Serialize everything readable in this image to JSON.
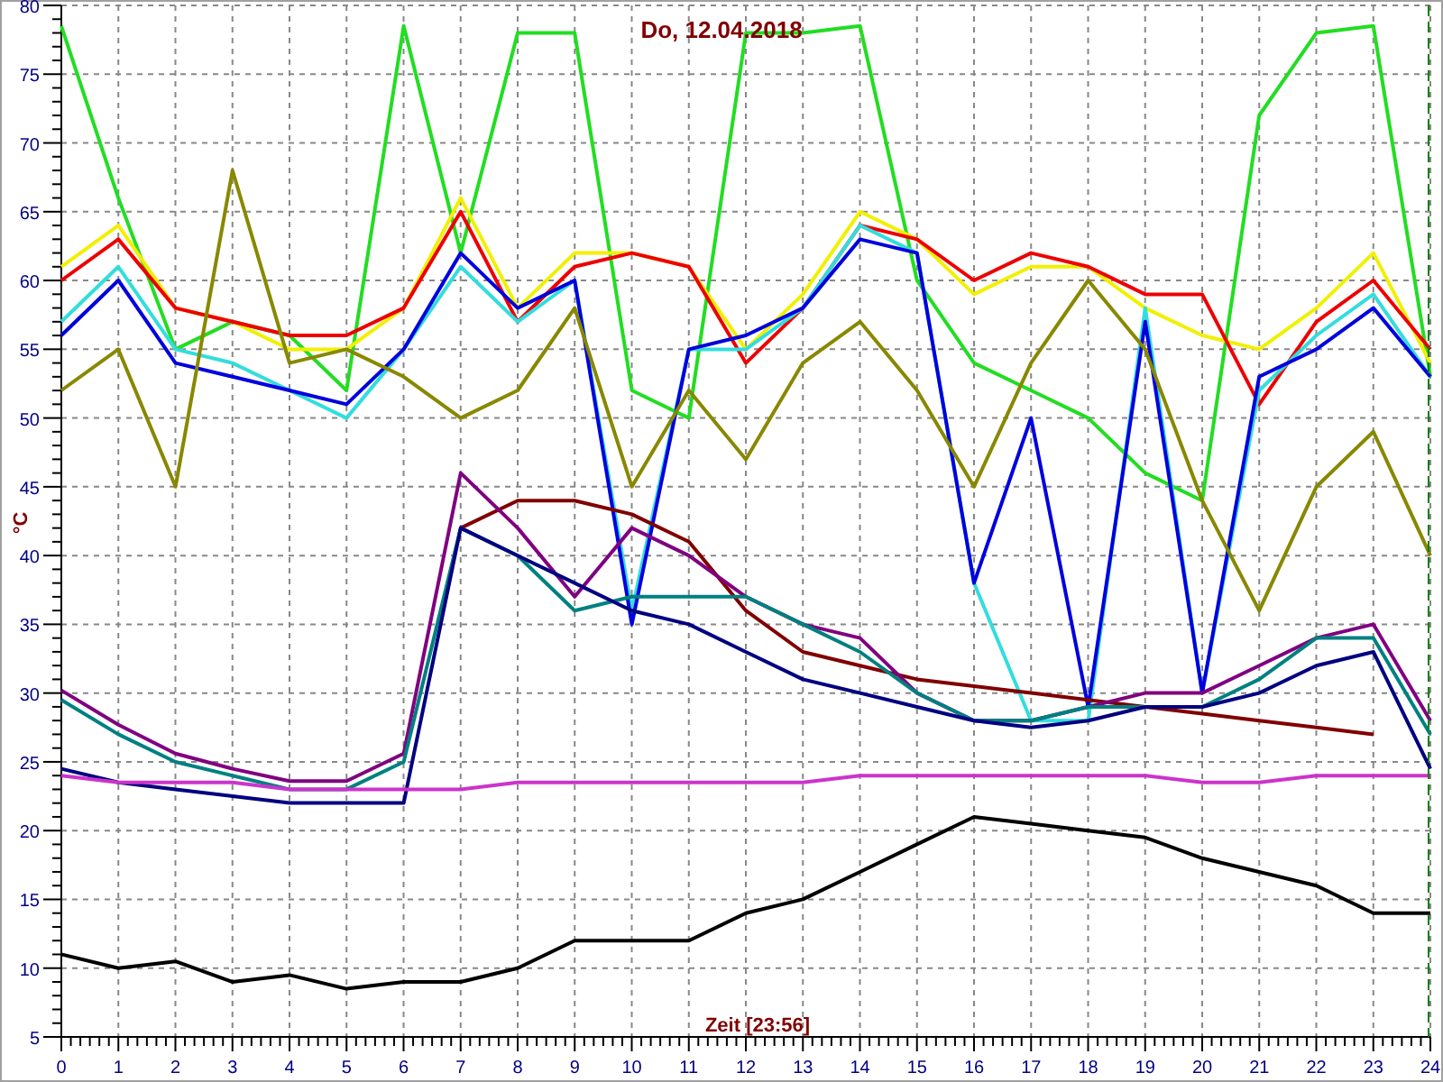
{
  "chart_data": {
    "type": "line",
    "grid": true,
    "title": "Do, 12.04.2018",
    "xlabel": "Zeit [23:56]",
    "ylabel": "°C",
    "x": [
      0,
      1,
      2,
      3,
      4,
      5,
      6,
      7,
      8,
      9,
      10,
      11,
      12,
      13,
      14,
      15,
      16,
      17,
      18,
      19,
      20,
      21,
      22,
      23,
      24
    ],
    "xlim": [
      0,
      24
    ],
    "ylim": [
      5,
      80
    ],
    "xticks": [
      0,
      1,
      2,
      3,
      4,
      5,
      6,
      7,
      8,
      9,
      10,
      11,
      12,
      13,
      14,
      15,
      16,
      17,
      18,
      19,
      20,
      21,
      22,
      23,
      24
    ],
    "yticks": [
      5,
      10,
      15,
      20,
      25,
      30,
      35,
      40,
      45,
      50,
      55,
      60,
      65,
      70,
      75,
      80
    ],
    "series": [
      {
        "color": "#22dd22",
        "values": [
          78.5,
          66,
          55,
          57,
          56,
          52,
          78.5,
          62,
          78,
          78,
          52,
          50,
          78,
          78,
          78.5,
          60,
          54,
          52,
          50,
          46,
          44,
          72,
          78,
          78.5,
          53
        ]
      },
      {
        "color": "#f0f000",
        "values": [
          61,
          64,
          58,
          57,
          55,
          55,
          58,
          66,
          58,
          62,
          62,
          61,
          55,
          59,
          65,
          63,
          59,
          61,
          61,
          58,
          56,
          55,
          58,
          62,
          54
        ]
      },
      {
        "color": "#ee0000",
        "values": [
          60,
          63,
          58,
          57,
          56,
          56,
          58,
          65,
          57,
          61,
          62,
          61,
          54,
          58,
          64,
          63,
          60,
          62,
          61,
          59,
          59,
          51,
          57,
          60,
          55
        ]
      },
      {
        "color": "#33dddd",
        "values": [
          57,
          61,
          55,
          54,
          52,
          50,
          55,
          61,
          57,
          60,
          36,
          55,
          55,
          58,
          64,
          62,
          38,
          28,
          28,
          58,
          30,
          52,
          56,
          59,
          53
        ]
      },
      {
        "color": "#0000dd",
        "values": [
          56,
          60,
          54,
          53,
          52,
          51,
          55,
          62,
          58,
          60,
          35,
          55,
          56,
          58,
          63,
          62,
          38,
          50,
          29,
          57,
          30,
          53,
          55,
          58,
          53
        ]
      },
      {
        "color": "#888800",
        "values": [
          52,
          55,
          45,
          68,
          54,
          55,
          53,
          50,
          52,
          58,
          45,
          52,
          47,
          54,
          57,
          52,
          45,
          54,
          60,
          55,
          44,
          36,
          45,
          49,
          40
        ]
      },
      {
        "color": "#800000",
        "values": [
          null,
          null,
          null,
          null,
          null,
          null,
          null,
          42,
          44,
          44,
          43,
          41,
          36,
          33,
          32,
          31,
          30.5,
          30,
          29.5,
          29,
          28.5,
          28,
          27.5,
          27,
          null
        ]
      },
      {
        "color": "#800080",
        "values": [
          30.2,
          27.7,
          25.6,
          24.5,
          23.6,
          23.6,
          25.6,
          46,
          42,
          37,
          42,
          40,
          37,
          35,
          34,
          30,
          28,
          28,
          29,
          30,
          30,
          32,
          34,
          35,
          28
        ]
      },
      {
        "color": "#008080",
        "values": [
          29.5,
          27,
          25,
          24,
          23,
          23,
          25,
          42,
          40,
          36,
          37,
          37,
          37,
          35,
          33,
          30,
          28,
          28,
          29,
          29,
          29,
          31,
          34,
          34,
          27
        ]
      },
      {
        "color": "#000080",
        "values": [
          24.5,
          23.5,
          23,
          22.5,
          22,
          22,
          22,
          42,
          40,
          38,
          36,
          35,
          33,
          31,
          30,
          29,
          28,
          27.5,
          28,
          29,
          29,
          30,
          32,
          33,
          24.5
        ]
      },
      {
        "color": "#cc33cc",
        "values": [
          24,
          23.5,
          23.5,
          23.5,
          23,
          23,
          23,
          23,
          23.5,
          23.5,
          23.5,
          23.5,
          23.5,
          23.5,
          24,
          24,
          24,
          24,
          24,
          24,
          23.5,
          23.5,
          24,
          24,
          24
        ]
      },
      {
        "color": "#000000",
        "values": [
          11,
          10,
          10.5,
          9,
          9.5,
          8.5,
          9,
          9,
          10,
          12,
          12,
          12,
          14,
          15,
          17,
          19,
          21,
          20.5,
          20,
          19.5,
          18,
          17,
          16,
          14,
          14
        ]
      }
    ]
  }
}
